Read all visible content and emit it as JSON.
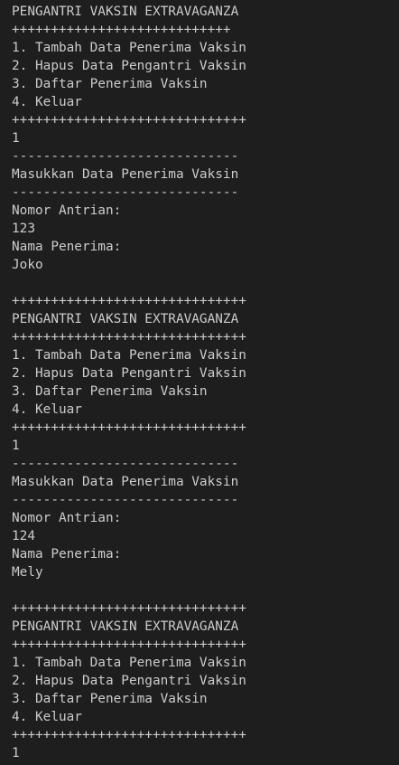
{
  "terminal": {
    "background": "#1e1e1e",
    "foreground": "#cccccc",
    "lines": [
      "PENGANTRI VAKSIN EXTRAVAGANZA",
      "++++++++++++++++++++++++++++",
      "1. Tambah Data Penerima Vaksin",
      "2. Hapus Data Pengantri Vaksin",
      "3. Daftar Penerima Vaksin",
      "4. Keluar",
      "++++++++++++++++++++++++++++++",
      "1",
      "-----------------------------",
      "Masukkan Data Penerima Vaksin",
      "-----------------------------",
      "Nomor Antrian:",
      "123",
      "Nama Penerima:",
      "Joko",
      "",
      "++++++++++++++++++++++++++++++",
      "PENGANTRI VAKSIN EXTRAVAGANZA",
      "++++++++++++++++++++++++++++++",
      "1. Tambah Data Penerima Vaksin",
      "2. Hapus Data Pengantri Vaksin",
      "3. Daftar Penerima Vaksin",
      "4. Keluar",
      "++++++++++++++++++++++++++++++",
      "1",
      "-----------------------------",
      "Masukkan Data Penerima Vaksin",
      "-----------------------------",
      "Nomor Antrian:",
      "124",
      "Nama Penerima:",
      "Mely",
      "",
      "++++++++++++++++++++++++++++++",
      "PENGANTRI VAKSIN EXTRAVAGANZA",
      "++++++++++++++++++++++++++++++",
      "1. Tambah Data Penerima Vaksin",
      "2. Hapus Data Pengantri Vaksin",
      "3. Daftar Penerima Vaksin",
      "4. Keluar",
      "++++++++++++++++++++++++++++++",
      "1"
    ]
  }
}
